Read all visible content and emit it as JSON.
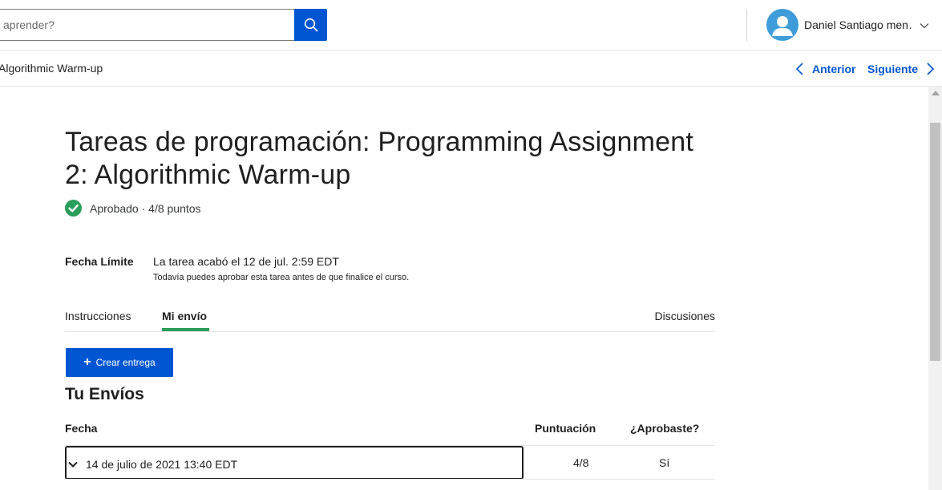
{
  "header": {
    "search_placeholder": "aprender?",
    "user_name": "Daniel Santiago men…"
  },
  "nav": {
    "breadcrumb": "Algorithmic Warm-up",
    "prev_label": "Anterior",
    "next_label": "Siguiente"
  },
  "assignment": {
    "title": "Tareas de programación: Programming Assignment 2: Algorithmic Warm-up",
    "status": "Aprobado · 4/8 puntos",
    "due_label": "Fecha Límite",
    "due_value": "La tarea acabó el 12 de jul. 2:59 EDT",
    "due_note": "Todavía puedes aprobar esta tarea antes de que finalice el curso."
  },
  "tabs": [
    {
      "label": "Instrucciones",
      "active": false
    },
    {
      "label": "Mi envío",
      "active": true
    },
    {
      "label": "Discusiones",
      "active": false
    }
  ],
  "create_button": "Crear entrega",
  "submissions": {
    "title": "Tu Envíos",
    "columns": [
      "Fecha",
      "Puntuación",
      "¿Aprobaste?"
    ],
    "rows": [
      {
        "date": "14 de julio de 2021 13:40 EDT",
        "score": "4/8",
        "passed": "Sí"
      }
    ]
  },
  "colors": {
    "brand_blue": "#0056d2",
    "success_green": "#2a9e5c",
    "avatar_blue": "#3d9cd9"
  },
  "icons": [
    "search-icon",
    "user-avatar-icon",
    "chevron-down-icon",
    "chevron-left-icon",
    "chevron-right-icon",
    "check-circle-icon",
    "plus-icon"
  ]
}
